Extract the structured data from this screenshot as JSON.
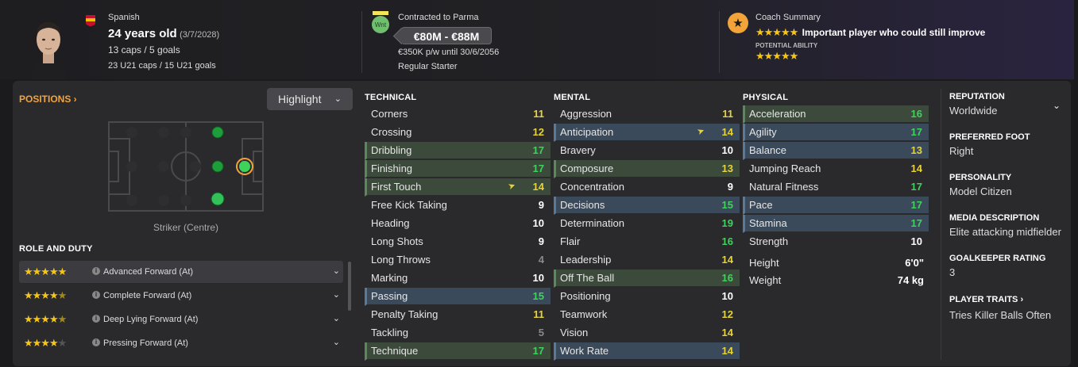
{
  "header": {
    "nationality": "Spanish",
    "age": "24 years old",
    "dob": "(3/7/2028)",
    "caps": "13 caps / 5 goals",
    "u21": "23 U21 caps / 15 U21 goals",
    "contract_club": "Contracted to Parma",
    "value": "€80M - €88M",
    "wage": "€350K p/w until 30/6/2056",
    "squad_status": "Regular Starter",
    "club_badge_text": "Wnt",
    "coach_title": "Coach Summary",
    "coach_summary": "Important player who could still improve",
    "potential_label": "POTENTIAL ABILITY",
    "current_ability_stars": 5,
    "potential_ability_stars": 5
  },
  "positions": {
    "title": "POSITIONS",
    "highlight_label": "Highlight",
    "selected_position": "Striker (Centre)"
  },
  "roles": {
    "title": "ROLE AND DUTY",
    "items": [
      {
        "label": "Advanced Forward (At)",
        "stars": 5
      },
      {
        "label": "Complete Forward (At)",
        "stars": 4.5
      },
      {
        "label": "Deep Lying Forward (At)",
        "stars": 4.5
      },
      {
        "label": "Pressing Forward (At)",
        "stars": 4
      }
    ]
  },
  "technical": {
    "title": "TECHNICAL",
    "rows": [
      {
        "name": "Corners",
        "value": "11",
        "hl": ""
      },
      {
        "name": "Crossing",
        "value": "12",
        "hl": ""
      },
      {
        "name": "Dribbling",
        "value": "17",
        "hl": "green"
      },
      {
        "name": "Finishing",
        "value": "17",
        "hl": "green"
      },
      {
        "name": "First Touch",
        "value": "14",
        "hl": "green",
        "arrow": true
      },
      {
        "name": "Free Kick Taking",
        "value": "9",
        "hl": ""
      },
      {
        "name": "Heading",
        "value": "10",
        "hl": ""
      },
      {
        "name": "Long Shots",
        "value": "9",
        "hl": ""
      },
      {
        "name": "Long Throws",
        "value": "4",
        "hl": ""
      },
      {
        "name": "Marking",
        "value": "10",
        "hl": ""
      },
      {
        "name": "Passing",
        "value": "15",
        "hl": "blue"
      },
      {
        "name": "Penalty Taking",
        "value": "11",
        "hl": ""
      },
      {
        "name": "Tackling",
        "value": "5",
        "hl": ""
      },
      {
        "name": "Technique",
        "value": "17",
        "hl": "green"
      }
    ]
  },
  "mental": {
    "title": "MENTAL",
    "rows": [
      {
        "name": "Aggression",
        "value": "11",
        "hl": ""
      },
      {
        "name": "Anticipation",
        "value": "14",
        "hl": "blue",
        "arrow": true
      },
      {
        "name": "Bravery",
        "value": "10",
        "hl": ""
      },
      {
        "name": "Composure",
        "value": "13",
        "hl": "green"
      },
      {
        "name": "Concentration",
        "value": "9",
        "hl": ""
      },
      {
        "name": "Decisions",
        "value": "15",
        "hl": "blue"
      },
      {
        "name": "Determination",
        "value": "19",
        "hl": ""
      },
      {
        "name": "Flair",
        "value": "16",
        "hl": ""
      },
      {
        "name": "Leadership",
        "value": "14",
        "hl": ""
      },
      {
        "name": "Off The Ball",
        "value": "16",
        "hl": "green"
      },
      {
        "name": "Positioning",
        "value": "10",
        "hl": ""
      },
      {
        "name": "Teamwork",
        "value": "12",
        "hl": ""
      },
      {
        "name": "Vision",
        "value": "14",
        "hl": ""
      },
      {
        "name": "Work Rate",
        "value": "14",
        "hl": "blue"
      }
    ]
  },
  "physical": {
    "title": "PHYSICAL",
    "rows": [
      {
        "name": "Acceleration",
        "value": "16",
        "hl": "green"
      },
      {
        "name": "Agility",
        "value": "17",
        "hl": "blue"
      },
      {
        "name": "Balance",
        "value": "13",
        "hl": "blue"
      },
      {
        "name": "Jumping Reach",
        "value": "14",
        "hl": ""
      },
      {
        "name": "Natural Fitness",
        "value": "17",
        "hl": ""
      },
      {
        "name": "Pace",
        "value": "17",
        "hl": "blue"
      },
      {
        "name": "Stamina",
        "value": "17",
        "hl": "blue"
      },
      {
        "name": "Strength",
        "value": "10",
        "hl": ""
      }
    ],
    "height_label": "Height",
    "height_value": "6'0\"",
    "weight_label": "Weight",
    "weight_value": "74 kg"
  },
  "info": {
    "reputation_title": "REPUTATION",
    "reputation": "Worldwide",
    "foot_title": "PREFERRED FOOT",
    "foot": "Right",
    "personality_title": "PERSONALITY",
    "personality": "Model Citizen",
    "media_title": "MEDIA DESCRIPTION",
    "media": "Elite attacking midfielder",
    "gk_title": "GOALKEEPER RATING",
    "gk": "3",
    "traits_title": "PLAYER TRAITS",
    "traits": "Tries Killer Balls Often"
  },
  "colors": {
    "accent": "#f2a33a",
    "green_value": "#3ed35a",
    "yellow_value": "#e6d23a",
    "grey_value": "#8a8a8a",
    "white_value": "#ffffff"
  }
}
